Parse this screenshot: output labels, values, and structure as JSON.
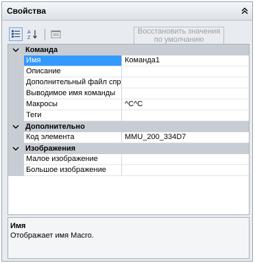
{
  "panel": {
    "title": "Свойства"
  },
  "toolbar": {
    "categorized_tooltip": "По категориям",
    "alphabetical_tooltip": "По алфавиту",
    "pages_tooltip": "Страницы свойств",
    "restore_label": "Восстановить значения по умолчанию"
  },
  "categories": [
    {
      "label": "Команда",
      "rows": [
        {
          "name": "Имя",
          "value": "Команда1",
          "selected": true
        },
        {
          "name": "Описание",
          "value": ""
        },
        {
          "name": "Дополнительный файл спр",
          "value": ""
        },
        {
          "name": "Выводимое имя команды",
          "value": ""
        },
        {
          "name": "Макросы",
          "value": "^C^C"
        },
        {
          "name": "Теги",
          "value": ""
        }
      ]
    },
    {
      "label": "Дополнительно",
      "rows": [
        {
          "name": "Код элемента",
          "value": "MMU_200_334D7"
        }
      ]
    },
    {
      "label": "Изображения",
      "rows": [
        {
          "name": "Малое изображение",
          "value": ""
        },
        {
          "name": "Большое изображение",
          "value": ""
        }
      ]
    }
  ],
  "description": {
    "title": "Имя",
    "text": "Отображает имя Macro."
  },
  "colors": {
    "selection": "#3399ff",
    "category_bg": "#c8cdd4",
    "panel_bg": "#e8ebef"
  }
}
